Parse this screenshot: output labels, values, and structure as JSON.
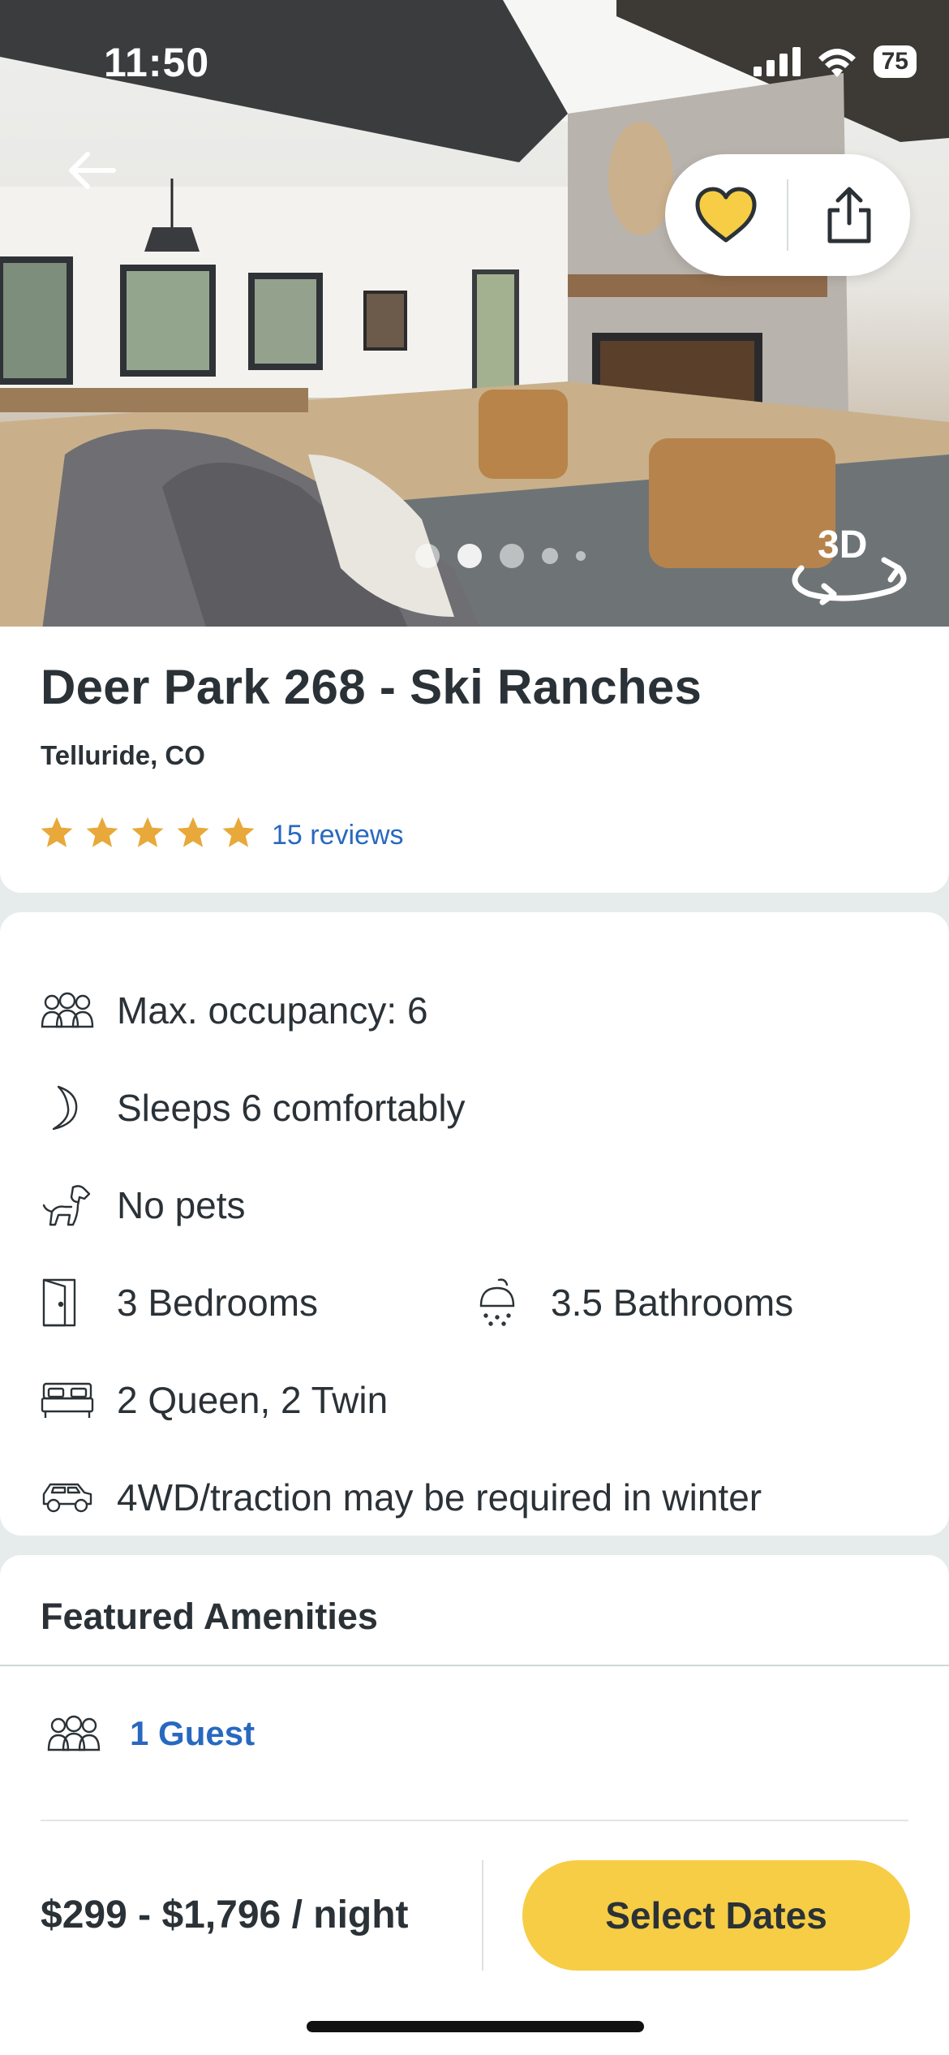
{
  "status_bar": {
    "time": "11:50",
    "battery": "75"
  },
  "hero": {
    "back_icon": "arrow-left-icon",
    "favorite_icon": "heart-icon",
    "share_icon": "share-icon",
    "badge_3d": "3D",
    "photo_count_dots": 5,
    "active_dot": 1
  },
  "property": {
    "title": "Deer Park 268 - Ski Ranches",
    "location": "Telluride, CO",
    "rating": 5,
    "reviews_label": "15 reviews"
  },
  "details": {
    "occupancy": "Max. occupancy: 6",
    "sleeps": "Sleeps 6 comfortably",
    "pets": "No pets",
    "bedrooms": "3 Bedrooms",
    "bathrooms": "3.5 Bathrooms",
    "beds": "2 Queen, 2 Twin",
    "vehicle": "4WD/traction may be required in winter"
  },
  "amenities": {
    "heading": "Featured Amenities"
  },
  "booking": {
    "guests_label": "1 Guest",
    "price": "$299 - $1,796 / night",
    "select_dates": "Select Dates"
  },
  "colors": {
    "accent_yellow": "#f6cd45",
    "link_blue": "#2868c0",
    "star_gold": "#e8a93a",
    "text_dark": "#2b3237"
  }
}
